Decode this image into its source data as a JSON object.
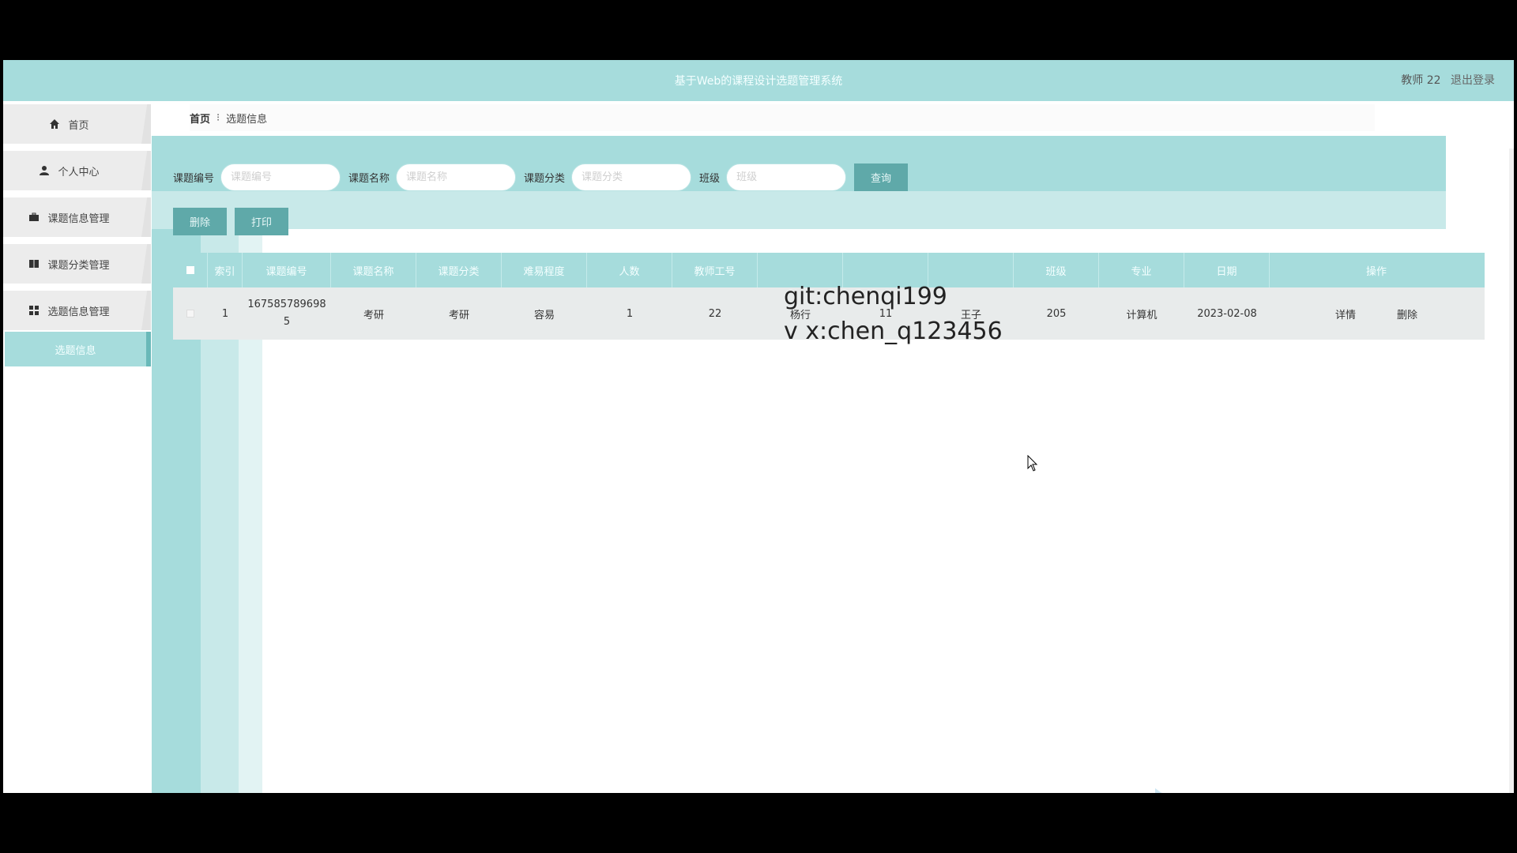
{
  "topbar": {
    "title": "基于Web的课程设计选题管理系统",
    "user": "教师 22",
    "logout": "退出登录"
  },
  "sidebar": {
    "items": [
      {
        "label": "首页",
        "icon": "home-icon"
      },
      {
        "label": "个人中心",
        "icon": "user-icon"
      },
      {
        "label": "课题信息管理",
        "icon": "briefcase-icon"
      },
      {
        "label": "课题分类管理",
        "icon": "book-icon"
      },
      {
        "label": "选题信息管理",
        "icon": "grid-icon"
      }
    ],
    "sub_item": "选题信息"
  },
  "breadcrumb": {
    "home": "首页",
    "sep": "⁝",
    "current": "选题信息"
  },
  "search": {
    "fields": [
      {
        "label": "课题编号",
        "placeholder": "课题编号"
      },
      {
        "label": "课题名称",
        "placeholder": "课题名称"
      },
      {
        "label": "课题分类",
        "placeholder": "课题分类"
      },
      {
        "label": "班级",
        "placeholder": "班级"
      }
    ],
    "button": "查询"
  },
  "actions": {
    "delete": "删除",
    "print": "打印"
  },
  "table": {
    "headers": [
      "索引",
      "课题编号",
      "课题名称",
      "课题分类",
      "难易程度",
      "人数",
      "教师工号",
      "",
      "",
      "",
      "班级",
      "专业",
      "日期",
      "操作"
    ],
    "rows": [
      {
        "index": "1",
        "code": "1675857896985",
        "name": "考研",
        "category": "考研",
        "difficulty": "容易",
        "count": "1",
        "teacher_no": "22",
        "teacher_name": "杨行",
        "student_no": "11",
        "student_name": "王子",
        "class": "205",
        "major": "计算机",
        "date": "2023-02-08",
        "detail": "详情",
        "delete": "删除"
      }
    ]
  },
  "watermark": {
    "line1": "git:chenqi199",
    "line2": "v x:chen_q123456"
  },
  "colors": {
    "accent": "#a6dcdc",
    "button": "#5fa9a9"
  }
}
